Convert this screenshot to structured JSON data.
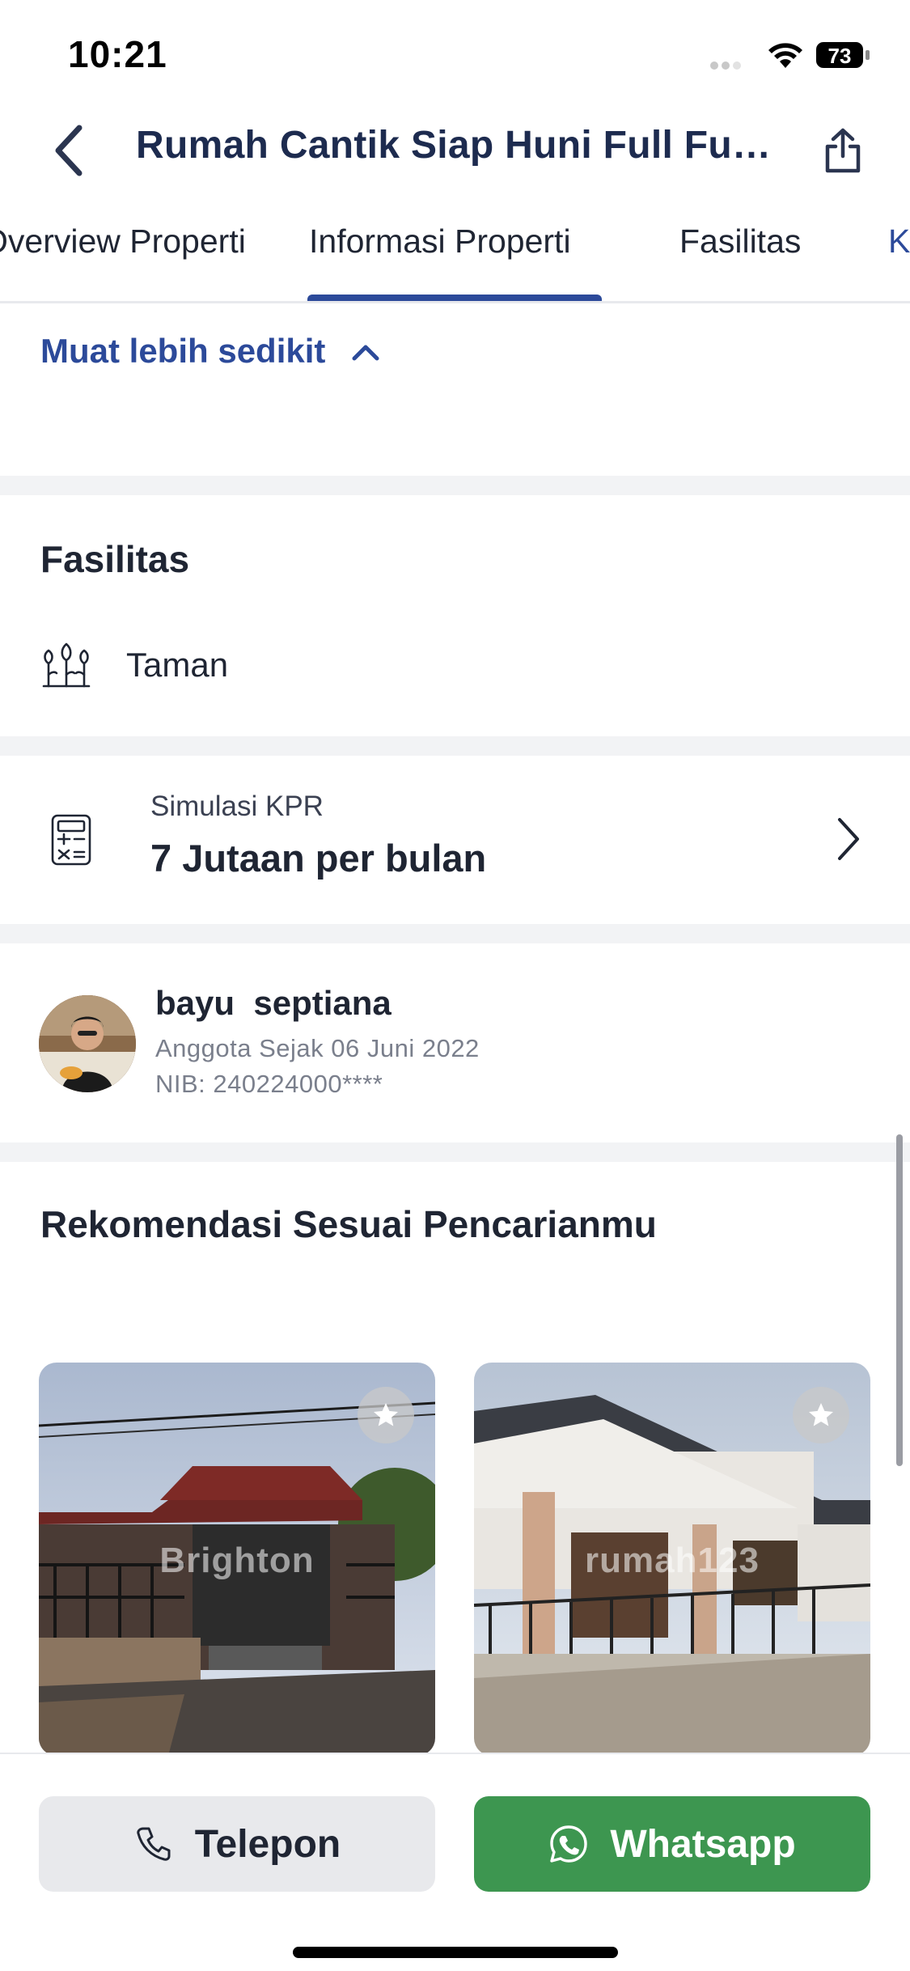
{
  "status_bar": {
    "time": "10:21",
    "battery": "73"
  },
  "header": {
    "title": "Rumah Cantik  Siap Huni Full Furnished",
    "back_icon": "chevron-left-icon",
    "share_icon": "share-icon"
  },
  "tabs": [
    {
      "label": "Overview Properti"
    },
    {
      "label": "Informasi Properti"
    },
    {
      "label": "Fasilitas"
    },
    {
      "label": "K"
    }
  ],
  "info": {
    "collapse_label": "Muat lebih sedikit"
  },
  "facilities": {
    "title": "Fasilitas",
    "items": [
      {
        "label": "Taman",
        "icon": "garden-icon"
      }
    ]
  },
  "kpr": {
    "label": "Simulasi KPR",
    "value": "7 Jutaan per bulan",
    "icon": "calculator-icon"
  },
  "agent": {
    "name": "bayu  septiana",
    "member_since": "Anggota Sejak 06 Juni 2022",
    "nib": "NIB: 240224000****"
  },
  "recommendations": {
    "title": "Rekomendasi Sesuai Pencarianmu",
    "cards": [
      {
        "watermark": "Brighton"
      },
      {
        "watermark": "rumah123"
      }
    ]
  },
  "actions": {
    "call_label": "Telepon",
    "whatsapp_label": "Whatsapp"
  },
  "colors": {
    "accent": "#2c4a9a",
    "whatsapp": "#3d9650",
    "divider": "#f2f3f5"
  }
}
